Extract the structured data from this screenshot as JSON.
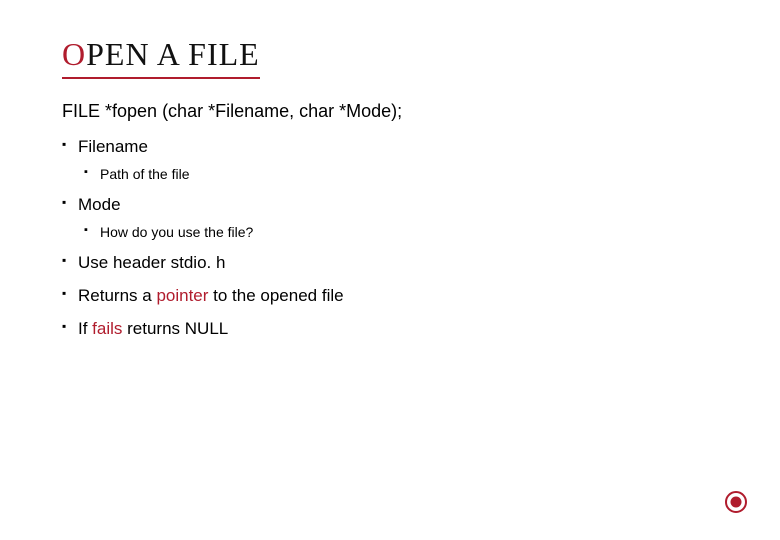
{
  "title": {
    "first": "O",
    "rest": "PEN A FILE"
  },
  "signature": "FILE *fopen (char *Filename, char *Mode);",
  "items": [
    {
      "label": "Filename",
      "sub": [
        {
          "label": "Path of the file"
        }
      ]
    },
    {
      "label": "Mode",
      "sub": [
        {
          "label": "How do you use the file?"
        }
      ]
    },
    {
      "segments": [
        {
          "text": "Use header stdio. h",
          "cls": ""
        }
      ]
    },
    {
      "segments": [
        {
          "text": "Returns a ",
          "cls": ""
        },
        {
          "text": "pointer",
          "cls": "highlight"
        },
        {
          "text": " to the opened file",
          "cls": ""
        }
      ]
    },
    {
      "segments": [
        {
          "text": "If ",
          "cls": ""
        },
        {
          "text": "fails",
          "cls": "highlight"
        },
        {
          "text": " returns NULL",
          "cls": ""
        }
      ]
    }
  ]
}
